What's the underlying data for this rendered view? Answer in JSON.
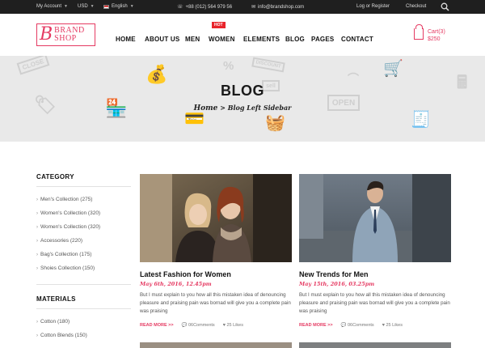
{
  "topbar": {
    "account": "My Account",
    "currency": "USD",
    "language": "English",
    "phone": "+88 (012) 564 979 56",
    "email": "info@brandshop.com",
    "login": "Log or Register",
    "checkout": "Checkout"
  },
  "logo": {
    "initial": "B",
    "line1": "BRAND",
    "line2": "SHOP"
  },
  "nav": {
    "home": "HOME",
    "about": "ABOUT US",
    "men": "MEN",
    "women": "WOMEN",
    "hot_badge": "HOT",
    "elements": "ELEMENTS",
    "blog": "BLOG",
    "pages": "PAGES",
    "contact": "CONTACT"
  },
  "cart": {
    "label": "Cart(3)",
    "amount": "$250"
  },
  "banner": {
    "title": "BLOG",
    "crumb_home": "Home",
    "crumb_current": "> Blog Left Sidebar",
    "deco_close": "CLOSE",
    "deco_sell": "sell",
    "deco_discount": "DISCOUNT",
    "deco_open": "OPEN"
  },
  "sidebar": {
    "category_title": "CATEGORY",
    "categories": [
      "Men's Collection (275)",
      "Women's Collection (320)",
      "Women's Collection (320)",
      "Accessories (220)",
      "Bag's Collection (175)",
      "Shoies Collection (150)"
    ],
    "materials_title": "MATERIALS",
    "materials": [
      "Cotton (180)",
      "Cotton Blends (150)"
    ]
  },
  "posts": [
    {
      "title": "Latest Fashion for Women",
      "date": "May 6th, 2016, 12.45pm",
      "excerpt": "But I must explain to you how all this mistaken idea of denouncing pleasure and praising pain was bornad will give you a complete pain was praising",
      "read_more": "READ MORE >>",
      "comments": "06Comments",
      "likes": "25 Likes"
    },
    {
      "title": "New Trends for Men",
      "date": "May 15th, 2016, 03.25pm",
      "excerpt": "But I must explain to you how all this mistaken idea of denouncing pleasure and praising pain was bornad will give you a complete pain was praising",
      "read_more": "READ MORE >>",
      "comments": "06Comments",
      "likes": "25 Likes"
    }
  ],
  "colors": {
    "accent": "#e53a62",
    "topbar": "#1f1f1f",
    "banner": "#e9e9e9"
  }
}
